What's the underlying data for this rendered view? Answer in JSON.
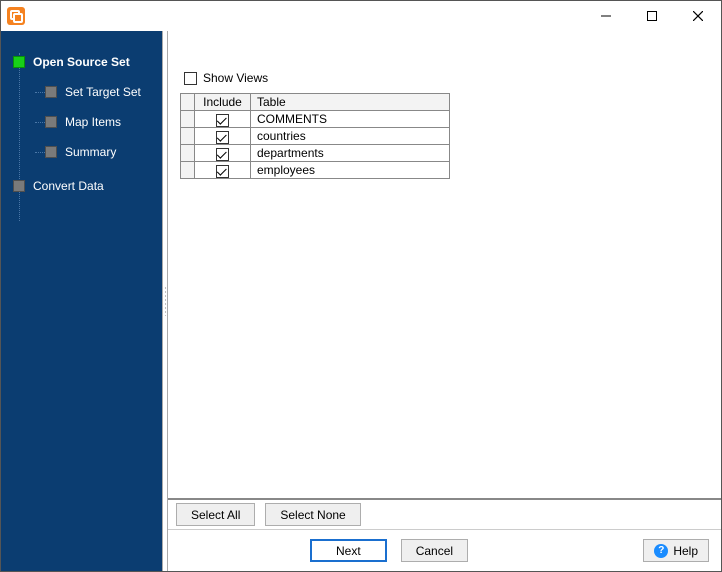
{
  "window": {
    "title": ""
  },
  "sidebar": {
    "steps": [
      {
        "label": "Open Source Set",
        "active": true,
        "kind": "root"
      },
      {
        "label": "Set Target Set",
        "active": false,
        "kind": "sub"
      },
      {
        "label": "Map Items",
        "active": false,
        "kind": "sub"
      },
      {
        "label": "Summary",
        "active": false,
        "kind": "sub"
      },
      {
        "label": "Convert Data",
        "active": false,
        "kind": "root2"
      }
    ]
  },
  "content": {
    "show_views_label": "Show Views",
    "show_views_checked": false,
    "columns": {
      "include": "Include",
      "table": "Table"
    },
    "rows": [
      {
        "include": true,
        "table": "COMMENTS"
      },
      {
        "include": true,
        "table": "countries"
      },
      {
        "include": true,
        "table": "departments"
      },
      {
        "include": true,
        "table": "employees"
      }
    ]
  },
  "buttons": {
    "select_all": "Select All",
    "select_none": "Select None",
    "next": "Next",
    "cancel": "Cancel",
    "help": "Help"
  }
}
